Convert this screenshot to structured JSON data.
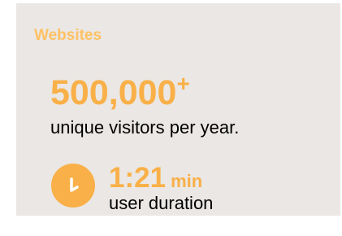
{
  "card": {
    "heading": "Websites",
    "visitors": {
      "value": "500,000",
      "suffix": "+",
      "caption": "unique visitors per year."
    },
    "duration": {
      "value": "1:21",
      "unit": "min",
      "caption": "user duration",
      "icon": "clock-icon"
    }
  },
  "colors": {
    "card_background": "#eae7e4",
    "heading": "#ffc164",
    "accent": "#f9b048",
    "body_text": "#000000"
  }
}
